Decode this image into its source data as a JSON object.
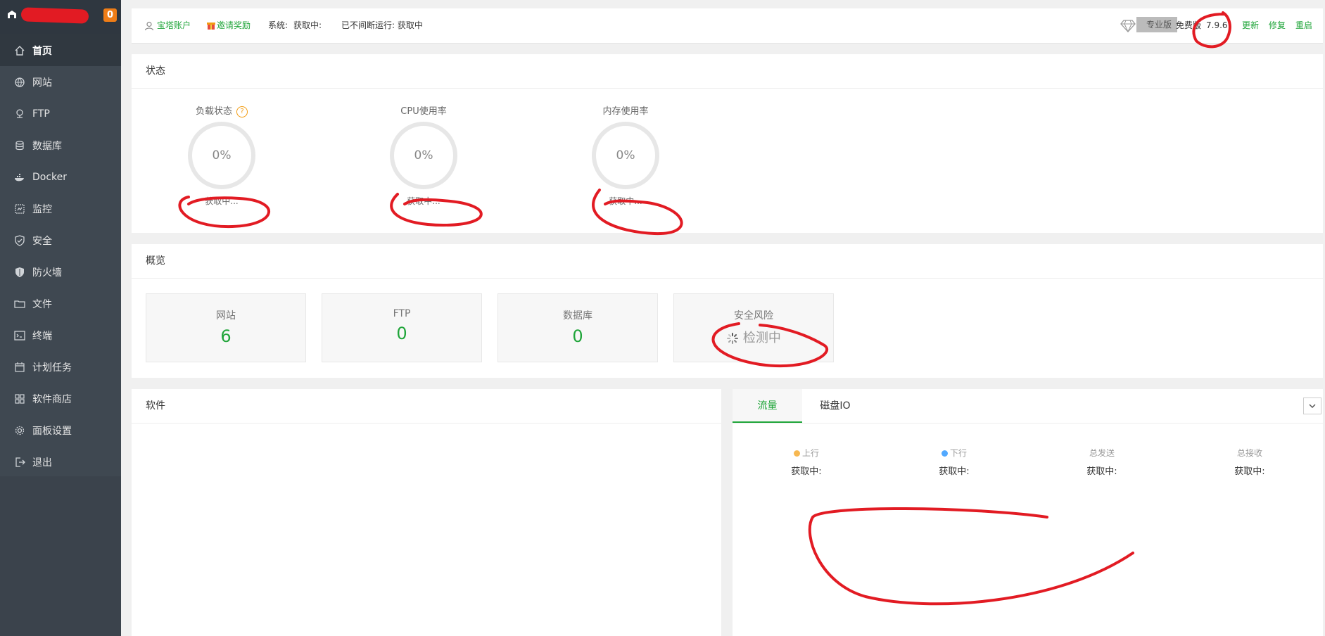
{
  "sidebar": {
    "badge": "0",
    "items": [
      {
        "label": "首页",
        "icon": "home-icon"
      },
      {
        "label": "网站",
        "icon": "globe-icon"
      },
      {
        "label": "FTP",
        "icon": "ftp-icon"
      },
      {
        "label": "数据库",
        "icon": "database-icon"
      },
      {
        "label": "Docker",
        "icon": "docker-icon"
      },
      {
        "label": "监控",
        "icon": "monitor-icon"
      },
      {
        "label": "安全",
        "icon": "shield-check-icon"
      },
      {
        "label": "防火墙",
        "icon": "firewall-shield-icon"
      },
      {
        "label": "文件",
        "icon": "folder-icon"
      },
      {
        "label": "终端",
        "icon": "terminal-icon"
      },
      {
        "label": "计划任务",
        "icon": "calendar-icon"
      },
      {
        "label": "软件商店",
        "icon": "apps-grid-icon"
      },
      {
        "label": "面板设置",
        "icon": "gear-icon"
      },
      {
        "label": "退出",
        "icon": "logout-icon"
      }
    ]
  },
  "topbar": {
    "account": "宝塔账户",
    "invite": "邀请奖励",
    "system_label": "系统:",
    "system_value": "获取中:",
    "uptime": "已不间断运行: 获取中",
    "pro_badge": "专业版",
    "free_label": "免费版",
    "version": "7.9.6",
    "update": "更新",
    "repair": "修复",
    "restart": "重启"
  },
  "status": {
    "title": "状态",
    "gauges": [
      {
        "label": "负载状态",
        "value": "0%",
        "status": "获取中..."
      },
      {
        "label": "CPU使用率",
        "value": "0%",
        "status": "获取中..."
      },
      {
        "label": "内存使用率",
        "value": "0%",
        "status": "获取中..."
      }
    ]
  },
  "overview": {
    "title": "概览",
    "cards": [
      {
        "label": "网站",
        "value": "6"
      },
      {
        "label": "FTP",
        "value": "0"
      },
      {
        "label": "数据库",
        "value": "0"
      },
      {
        "label": "安全风险",
        "value": "检测中"
      }
    ]
  },
  "software": {
    "title": "软件"
  },
  "traffic": {
    "tabs": [
      "流量",
      "磁盘IO"
    ],
    "columns": [
      {
        "label": "上行",
        "value": "获取中:",
        "dot": "#f7b851"
      },
      {
        "label": "下行",
        "value": "获取中:",
        "dot": "#52a9ff"
      },
      {
        "label": "总发送",
        "value": "获取中:"
      },
      {
        "label": "总接收",
        "value": "获取中:"
      }
    ]
  },
  "colors": {
    "accent": "#20a53a",
    "sidebar": "#3f4851",
    "annotation": "#e21b23"
  }
}
